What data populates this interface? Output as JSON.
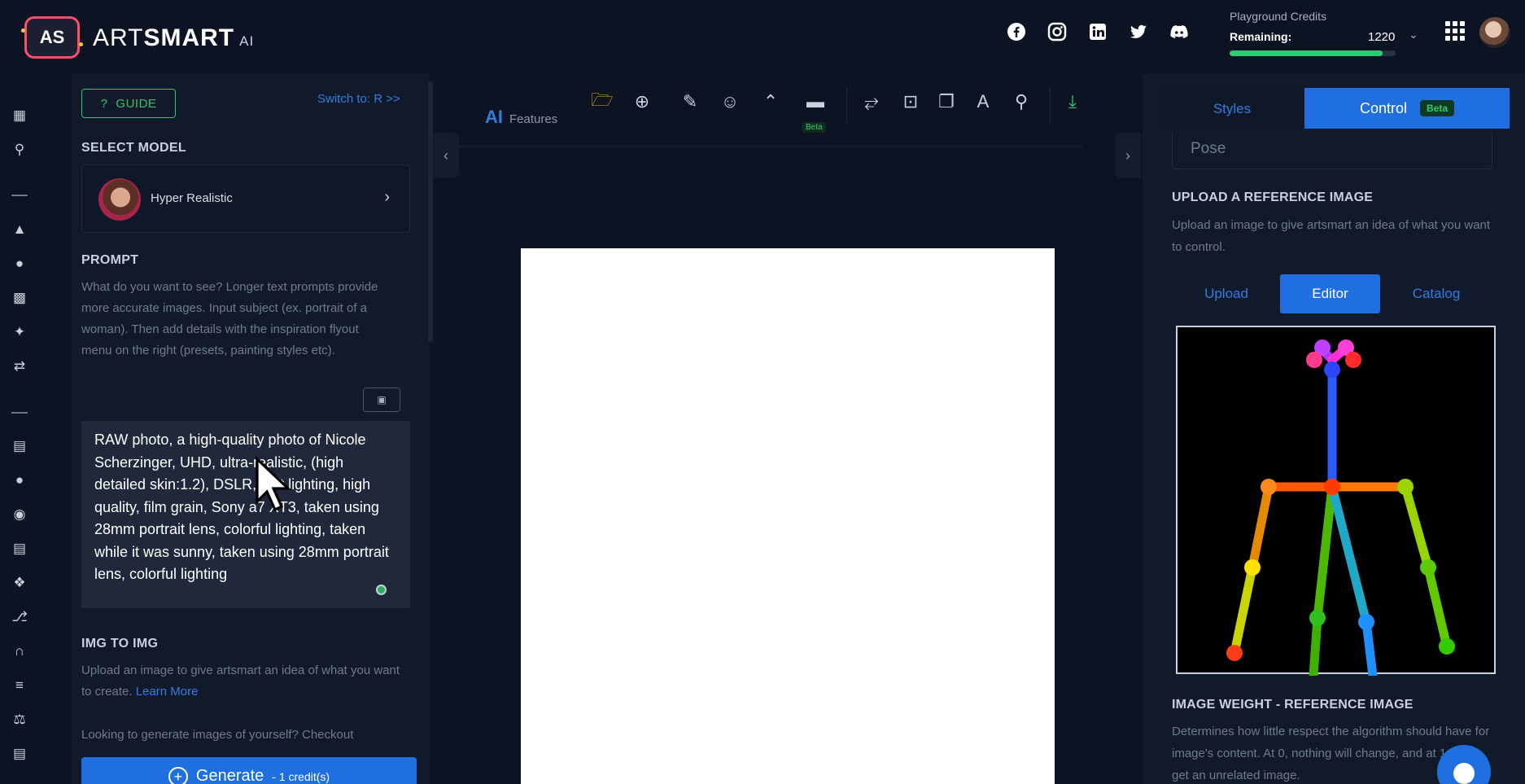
{
  "brand": {
    "badge": "AS",
    "name_light": "ART",
    "name_bold": "SMART",
    "suffix": "AI"
  },
  "social": [
    "facebook-icon",
    "instagram-icon",
    "linkedin-icon",
    "twitter-icon",
    "discord-icon"
  ],
  "credits": {
    "label": "Playground Credits",
    "remaining_label": "Remaining:",
    "value": "1220",
    "progress": 0.92
  },
  "left": {
    "guide_label": "GUIDE",
    "switch_label": "Switch to: R >>",
    "select_model_title": "SELECT MODEL",
    "model_name": "Hyper Realistic",
    "prompt_title": "PROMPT",
    "prompt_help": "What do you want to see? Longer text prompts provide more accurate images. Input subject (ex. portrait of a woman). Then add details with the inspiration flyout menu on the right (presets, painting styles etc).",
    "prompt_value": "RAW photo, a high-quality photo of Nicole Scherzinger, UHD, ultra-realistic, (high detailed skin:1.2), DSLR, soft lighting, high quality, film grain, Sony a7 XT3, taken using 28mm portrait lens, colorful lighting, taken while it was sunny, taken using 28mm portrait lens, colorful lighting",
    "img2img_title": "IMG TO IMG",
    "img2img_help": "Upload an image to give artsmart an idea of what you want to create.",
    "learn_more": "Learn More",
    "yourself_text": "Looking to generate images of yourself? Checkout",
    "generate_label": "Generate",
    "generate_cost": "- 1 credit(s)"
  },
  "toolbar": {
    "ai_label": "AI",
    "features_label": "Features",
    "beta_label": "Beta"
  },
  "right": {
    "tab_styles": "Styles",
    "tab_control": "Control",
    "control_badge": "Beta",
    "pose_value": "Pose",
    "upload_title": "UPLOAD A REFERENCE IMAGE",
    "upload_help": "Upload an image to give artsmart an idea of what you want to control.",
    "sub_tabs": [
      "Upload",
      "Editor",
      "Catalog"
    ],
    "weight_title": "IMAGE WEIGHT - REFERENCE IMAGE",
    "weight_help": "Determines how little respect the algorithm should have for image's content. At 0, nothing will change, and at 1 you'll get an unrelated image."
  },
  "colors": {
    "accent": "#1f6fe0",
    "success": "#2ecc71",
    "brand_red": "#ff4d6d",
    "bg": "#0c1424"
  }
}
